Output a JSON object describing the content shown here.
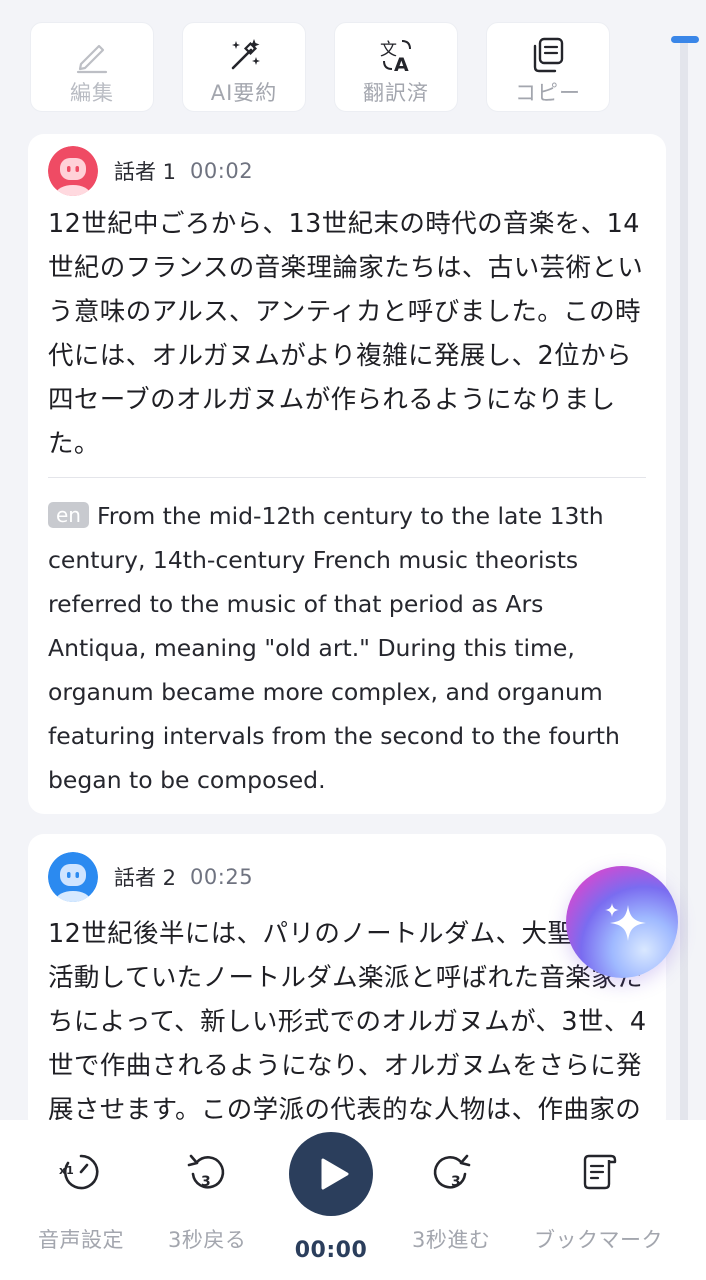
{
  "toolbar": {
    "edit_label": "編集",
    "ai_summary_label": "AI要約",
    "translated_label": "翻訳済",
    "copy_label": "コピー"
  },
  "transcript": [
    {
      "speaker": "話者 1",
      "time": "00:02",
      "text_jp": "12世紀中ごろから、13世紀末の時代の音楽を、14世紀のフランスの音楽理論家たちは、古い芸術という意味のアルス、アンティカと呼びました。この時代には、オルガヌムがより複雑に発展し、2位から四セーブのオルガヌムが作られるようになりました。",
      "lang_badge": "en",
      "text_en": "From the mid-12th century to the late 13th century, 14th-century French music theorists referred to the music of that period as Ars Antiqua, meaning \"old art.\" During this time, organum became more complex, and organum featuring intervals from the second to the fourth began to be composed."
    },
    {
      "speaker": "話者 2",
      "time": "00:25",
      "text_jp": "12世紀後半には、パリのノートルダム、大聖堂で活動していたノートルダム楽派と呼ばれた音楽家たちによって、新しい形式でのオルガヌムが、3世、4世で作曲されるようになり、オルガヌムをさらに発展させます。この学派の代表的な人物は、作曲家の"
    }
  ],
  "player": {
    "audio_settings_label": "音声設定",
    "rewind_label": "3秒戻る",
    "current_time": "00:00",
    "forward_label": "3秒進む",
    "bookmark_label": "ブックマーク",
    "rewind_icon_text": "3",
    "forward_icon_text": "3",
    "speed_icon_text": "x1"
  },
  "colors": {
    "accent": "#3a86e8",
    "player_button": "#2b3e5c",
    "speaker1_avatar": "#ef4b64",
    "speaker2_avatar": "#2b8af0"
  }
}
